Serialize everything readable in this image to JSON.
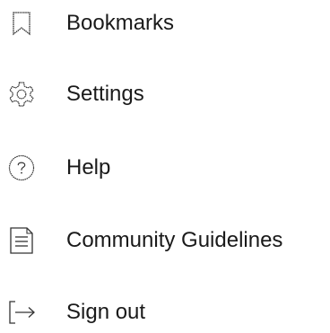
{
  "menu": {
    "items": [
      {
        "label": "Bookmarks",
        "icon": "bookmark-icon"
      },
      {
        "label": "Settings",
        "icon": "gear-icon"
      },
      {
        "label": "Help",
        "icon": "help-circle-icon"
      },
      {
        "label": "Community Guidelines",
        "icon": "document-lines-icon"
      },
      {
        "label": "Sign out",
        "icon": "sign-out-icon"
      }
    ]
  },
  "colors": {
    "text": "#1a1a1a",
    "icon_stroke": "#333333",
    "background": "#ffffff"
  }
}
